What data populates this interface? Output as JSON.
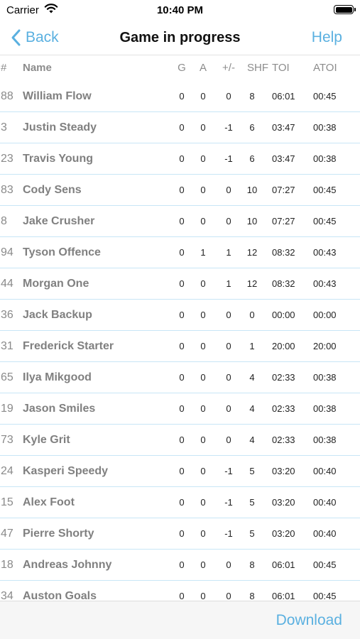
{
  "status_bar": {
    "carrier": "Carrier",
    "time": "10:40 PM"
  },
  "nav": {
    "back_label": "Back",
    "title": "Game in progress",
    "help_label": "Help"
  },
  "colors": {
    "accent": "#5ab0e0",
    "row_divider": "#c8e6f6",
    "toolbar_bg": "#f6f6f6"
  },
  "icons": {
    "wifi": "wifi-icon",
    "battery": "battery-icon",
    "back": "chevron-left-icon"
  },
  "table": {
    "columns": [
      "#",
      "Name",
      "G",
      "A",
      "+/-",
      "SHF",
      "TOI",
      "ATOI"
    ],
    "rows": [
      [
        "88",
        "William Flow",
        "0",
        "0",
        "0",
        "8",
        "06:01",
        "00:45"
      ],
      [
        "3",
        "Justin Steady",
        "0",
        "0",
        "-1",
        "6",
        "03:47",
        "00:38"
      ],
      [
        "23",
        "Travis Young",
        "0",
        "0",
        "-1",
        "6",
        "03:47",
        "00:38"
      ],
      [
        "83",
        "Cody Sens",
        "0",
        "0",
        "0",
        "10",
        "07:27",
        "00:45"
      ],
      [
        "8",
        "Jake Crusher",
        "0",
        "0",
        "0",
        "10",
        "07:27",
        "00:45"
      ],
      [
        "94",
        "Tyson Offence",
        "0",
        "1",
        "1",
        "12",
        "08:32",
        "00:43"
      ],
      [
        "44",
        "Morgan One",
        "0",
        "0",
        "1",
        "12",
        "08:32",
        "00:43"
      ],
      [
        "36",
        "Jack Backup",
        "0",
        "0",
        "0",
        "0",
        "00:00",
        "00:00"
      ],
      [
        "31",
        "Frederick Starter",
        "0",
        "0",
        "0",
        "1",
        "20:00",
        "20:00"
      ],
      [
        "65",
        "Ilya Mikgood",
        "0",
        "0",
        "0",
        "4",
        "02:33",
        "00:38"
      ],
      [
        "19",
        "Jason Smiles",
        "0",
        "0",
        "0",
        "4",
        "02:33",
        "00:38"
      ],
      [
        "73",
        "Kyle Grit",
        "0",
        "0",
        "0",
        "4",
        "02:33",
        "00:38"
      ],
      [
        "24",
        "Kasperi Speedy",
        "0",
        "0",
        "-1",
        "5",
        "03:20",
        "00:40"
      ],
      [
        "15",
        "Alex Foot",
        "0",
        "0",
        "-1",
        "5",
        "03:20",
        "00:40"
      ],
      [
        "47",
        "Pierre Shorty",
        "0",
        "0",
        "-1",
        "5",
        "03:20",
        "00:40"
      ],
      [
        "18",
        "Andreas Johnny",
        "0",
        "0",
        "0",
        "8",
        "06:01",
        "00:45"
      ],
      [
        "34",
        "Auston Goals",
        "0",
        "0",
        "0",
        "8",
        "06:01",
        "00:45"
      ]
    ]
  },
  "toolbar": {
    "download_label": "Download"
  }
}
